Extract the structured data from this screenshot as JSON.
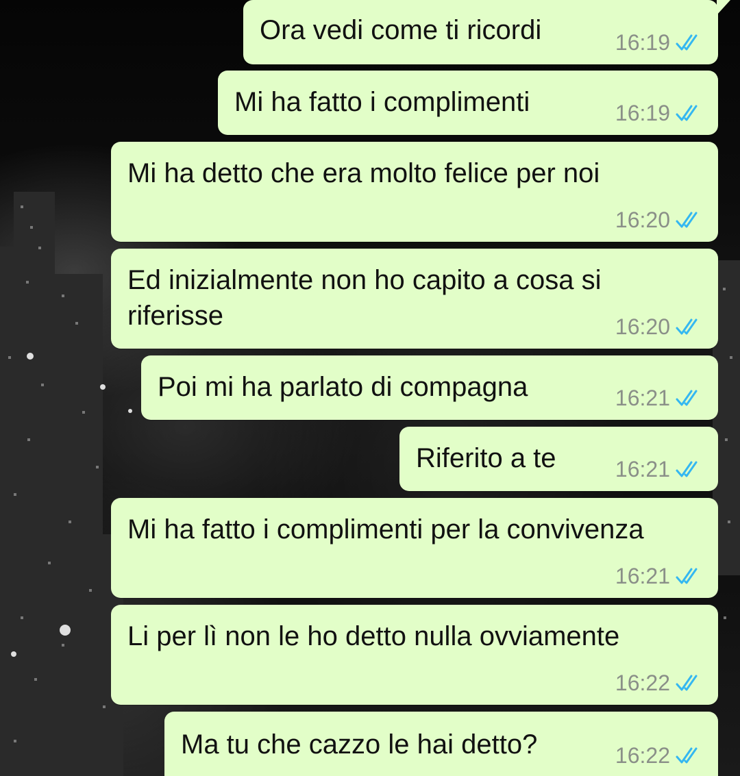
{
  "colors": {
    "bubble_bg": "#e2fec8",
    "time_text": "#8a8f88",
    "read_tick": "#34b7f1"
  },
  "icons": {
    "read_receipt": "double-check-icon"
  },
  "messages": [
    {
      "text": "Ora vedi come ti ricordi",
      "time": "16:19"
    },
    {
      "text": "Mi ha fatto i complimenti",
      "time": "16:19"
    },
    {
      "text": "Mi ha detto che era molto felice per noi",
      "time": "16:20"
    },
    {
      "text": "Ed inizialmente non ho capito a cosa si\nriferisse",
      "time": "16:20"
    },
    {
      "text": "Poi mi ha parlato di compagna",
      "time": "16:21"
    },
    {
      "text": "Riferito a te",
      "time": "16:21"
    },
    {
      "text": "Mi ha fatto i complimenti per la convivenza",
      "time": "16:21"
    },
    {
      "text": "Li per lì non le ho detto nulla ovviamente",
      "time": "16:22"
    },
    {
      "text": "Ma tu che cazzo le hai detto?",
      "time": "16:22"
    }
  ]
}
